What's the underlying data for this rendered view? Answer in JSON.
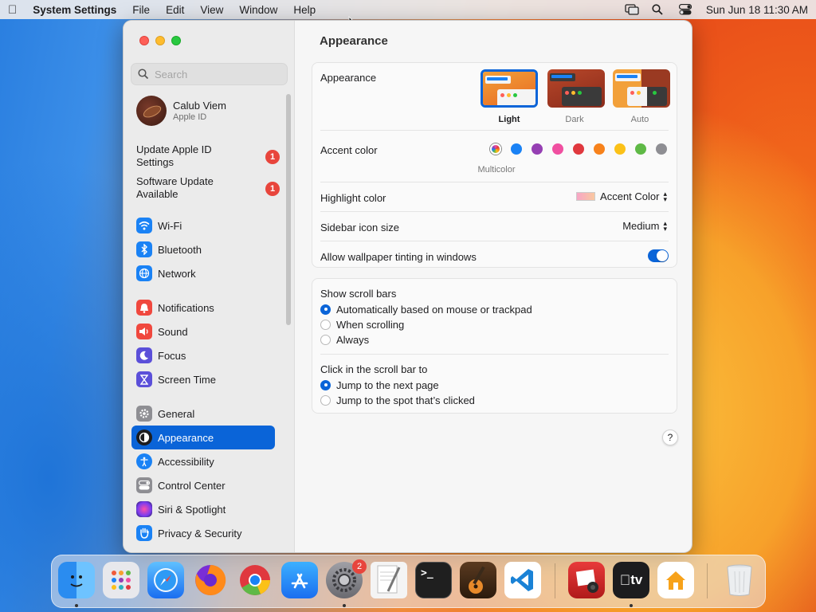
{
  "menubar": {
    "app_name": "System Settings",
    "menus": [
      "File",
      "Edit",
      "View",
      "Window",
      "Help"
    ],
    "clock": "Sun Jun 18  11:30 AM"
  },
  "sidebar": {
    "search_placeholder": "Search",
    "profile": {
      "name": "Calub Viem",
      "subtitle": "Apple ID"
    },
    "notices": [
      {
        "label": "Update Apple ID Settings",
        "badge": "1"
      },
      {
        "label": "Software Update Available",
        "badge": "1"
      }
    ],
    "items": [
      {
        "label": "Wi-Fi",
        "icon": "wifi-icon",
        "color": "#1a82f5"
      },
      {
        "label": "Bluetooth",
        "icon": "bluetooth-icon",
        "color": "#1a82f5"
      },
      {
        "label": "Network",
        "icon": "network-icon",
        "color": "#1a82f5"
      },
      {
        "label": "Notifications",
        "icon": "bell-icon",
        "color": "#f0483e"
      },
      {
        "label": "Sound",
        "icon": "speaker-icon",
        "color": "#f0483e"
      },
      {
        "label": "Focus",
        "icon": "moon-icon",
        "color": "#5b4fd9"
      },
      {
        "label": "Screen Time",
        "icon": "hourglass-icon",
        "color": "#5b4fd9"
      },
      {
        "label": "General",
        "icon": "gear-icon",
        "color": "#8e8e93"
      },
      {
        "label": "Appearance",
        "icon": "appearance-icon",
        "color": "#1d1d1f",
        "selected": true
      },
      {
        "label": "Accessibility",
        "icon": "accessibility-icon",
        "color": "#1a82f5"
      },
      {
        "label": "Control Center",
        "icon": "control-center-icon",
        "color": "#8e8e93"
      },
      {
        "label": "Siri & Spotlight",
        "icon": "siri-icon",
        "color": "#b73ce0"
      },
      {
        "label": "Privacy & Security",
        "icon": "hand-icon",
        "color": "#1a82f5"
      }
    ]
  },
  "main": {
    "title": "Appearance",
    "appearance": {
      "label": "Appearance",
      "options": [
        {
          "label": "Light",
          "selected": true
        },
        {
          "label": "Dark",
          "selected": false
        },
        {
          "label": "Auto",
          "selected": false
        }
      ]
    },
    "accent": {
      "label": "Accent color",
      "selected_name": "Multicolor",
      "colors": [
        "#1a82f5",
        "#953fb3",
        "#f04fa0",
        "#e0383e",
        "#f7821b",
        "#fbc118",
        "#5fb946",
        "#8e8e93"
      ]
    },
    "highlight": {
      "label": "Highlight color",
      "value": "Accent Color"
    },
    "sidebar_icon_size": {
      "label": "Sidebar icon size",
      "value": "Medium"
    },
    "wallpaper_tinting": {
      "label": "Allow wallpaper tinting in windows",
      "enabled": true
    },
    "scroll_bars": {
      "label": "Show scroll bars",
      "options": [
        {
          "label": "Automatically based on mouse or trackpad",
          "selected": true
        },
        {
          "label": "When scrolling",
          "selected": false
        },
        {
          "label": "Always",
          "selected": false
        }
      ]
    },
    "click_scroll": {
      "label": "Click in the scroll bar to",
      "options": [
        {
          "label": "Jump to the next page",
          "selected": true
        },
        {
          "label": "Jump to the spot that’s clicked",
          "selected": false
        }
      ]
    },
    "help_label": "?"
  },
  "dock": {
    "apps": [
      {
        "name": "finder-icon",
        "color": "#2a8cf0"
      },
      {
        "name": "launchpad-icon",
        "color": "#e8e8ec"
      },
      {
        "name": "safari-icon",
        "color": "#1e8ef2"
      },
      {
        "name": "firefox-icon",
        "color": "#7a2ed6"
      },
      {
        "name": "chrome-icon",
        "color": "#ffffff"
      },
      {
        "name": "app-store-icon",
        "color": "#1b8ef4"
      },
      {
        "name": "system-settings-icon",
        "color": "#7d7d82",
        "badge": "2"
      },
      {
        "name": "textedit-icon",
        "color": "#f4f4f4"
      },
      {
        "name": "terminal-icon",
        "color": "#1f1f1f"
      },
      {
        "name": "garageband-icon",
        "color": "#3a2a1a"
      },
      {
        "name": "vscode-icon",
        "color": "#ffffff"
      },
      {
        "name": "photo-booth-icon",
        "color": "#d8282a"
      },
      {
        "name": "apple-tv-icon",
        "color": "#1c1c1e"
      },
      {
        "name": "home-icon",
        "color": "#ffffff"
      },
      {
        "name": "trash-icon",
        "color": "#e6e8ea"
      }
    ],
    "tv_label": "tv"
  }
}
